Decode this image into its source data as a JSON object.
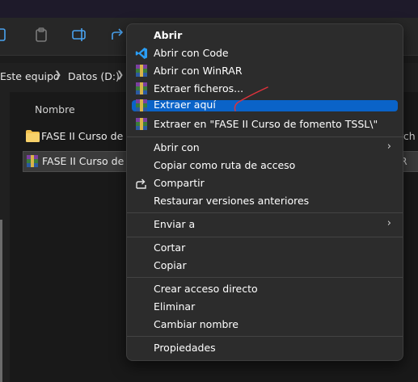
{
  "breadcrumb": {
    "items": [
      "Este equipo",
      "Datos (D:)"
    ]
  },
  "file_list": {
    "column_name": "Nombre",
    "rows": [
      {
        "name": "FASE II Curso de fomento TSSL",
        "type": "folder",
        "right_text": "rch"
      },
      {
        "name": "FASE II Curso de fomento TSSL.rar",
        "type": "rar",
        "selected": true,
        "right_text": "R"
      }
    ]
  },
  "context_menu": {
    "items": [
      {
        "label": "Abrir",
        "icon": "none",
        "bold": true
      },
      {
        "label": "Abrir con Code",
        "icon": "vscode-icon"
      },
      {
        "label": "Abrir con WinRAR",
        "icon": "winrar-icon"
      },
      {
        "label": "Extraer ficheros...",
        "icon": "winrar-icon"
      },
      {
        "label": "Extraer aquí",
        "icon": "winrar-icon",
        "highlighted": true
      },
      {
        "label": "Extraer en \"FASE II Curso de fomento TSSL\\\"",
        "icon": "winrar-icon"
      },
      {
        "label": "Abrir con",
        "icon": "none",
        "submenu": true
      },
      {
        "label": "Copiar como ruta de acceso",
        "icon": "none"
      },
      {
        "label": "Compartir",
        "icon": "share-icon"
      },
      {
        "label": "Restaurar versiones anteriores",
        "icon": "none"
      },
      {
        "label": "Enviar a",
        "icon": "none",
        "submenu": true
      },
      {
        "label": "Cortar",
        "icon": "none"
      },
      {
        "label": "Copiar",
        "icon": "none"
      },
      {
        "label": "Crear acceso directo",
        "icon": "none"
      },
      {
        "label": "Eliminar",
        "icon": "none"
      },
      {
        "label": "Cambiar nombre",
        "icon": "none"
      },
      {
        "label": "Propiedades",
        "icon": "none"
      }
    ]
  },
  "colors": {
    "highlight": "#0a63c8",
    "menu_bg": "#2c2c2c",
    "annotation": "#e0323c"
  }
}
